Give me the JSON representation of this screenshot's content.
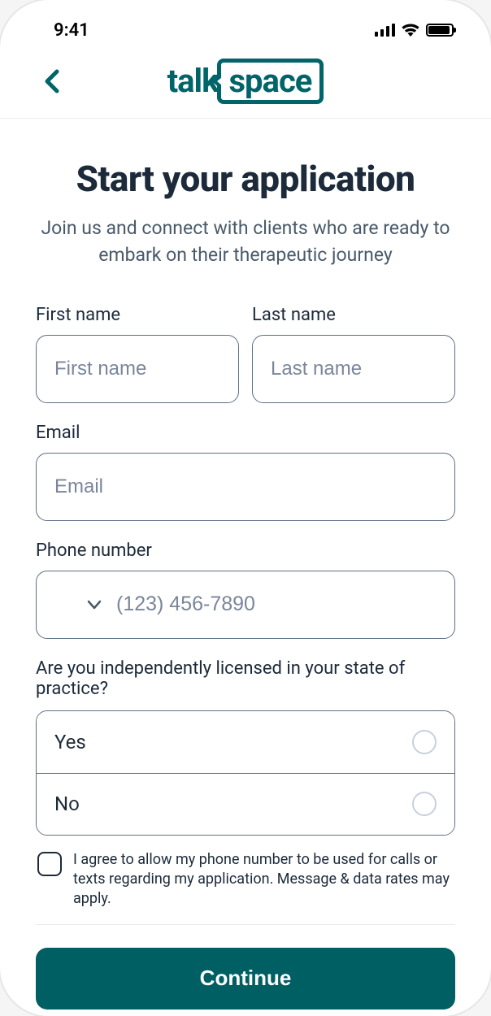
{
  "status": {
    "time": "9:41"
  },
  "logo": {
    "part1": "talk",
    "part2": "space"
  },
  "page": {
    "title": "Start your application",
    "subtitle": "Join us and connect with clients who are ready to embark on their therapeutic journey"
  },
  "form": {
    "first_name": {
      "label": "First name",
      "placeholder": "First name",
      "value": ""
    },
    "last_name": {
      "label": "Last name",
      "placeholder": "Last name",
      "value": ""
    },
    "email": {
      "label": "Email",
      "placeholder": "Email",
      "value": ""
    },
    "phone": {
      "label": "Phone number",
      "placeholder": "(123) 456-7890",
      "value": ""
    },
    "license_question": "Are you independently licensed in your state of practice?",
    "license_options": {
      "yes": "Yes",
      "no": "No"
    },
    "consent_text": "I agree to allow my phone number to be used for calls or texts regarding my application. Message & data rates may apply."
  },
  "actions": {
    "continue": "Continue"
  },
  "colors": {
    "brand": "#006469",
    "text_dark": "#1c2a3a",
    "border": "#5f6f84"
  }
}
